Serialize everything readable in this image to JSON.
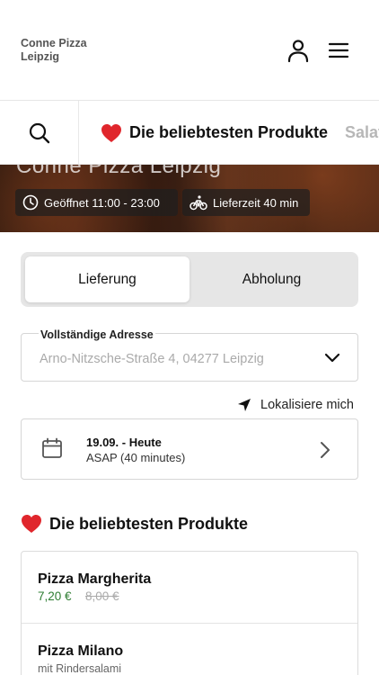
{
  "header": {
    "brand": "Conne Pizza Leipzig",
    "icons": {
      "user": "user-icon",
      "menu": "hamburger-menu-icon"
    }
  },
  "hero": {
    "title": "Conne Pizza Leipzig",
    "opening": "Geöffnet 11:00 - 23:00",
    "delivery_time": "Lieferzeit 40 min",
    "icons": {
      "opening": "clock-icon",
      "delivery": "bicycle-icon"
    }
  },
  "category_bar": {
    "icons": {
      "search": "search-icon",
      "active": "heart-icon"
    },
    "active_label": "Die beliebtesten Produkte",
    "next_label": "Salat"
  },
  "order_mode": {
    "options": [
      "Lieferung",
      "Abholung"
    ],
    "selected": "Lieferung"
  },
  "address": {
    "label": "Vollständige Adresse",
    "placeholder": "Arno-Nitzsche-Straße 4, 04277 Leipzig",
    "icon": "chevron-down-icon"
  },
  "locate": {
    "label": "Lokalisiere mich",
    "icon": "location-arrow-icon"
  },
  "schedule": {
    "date": "19.09. - Heute",
    "time": "ASAP (40 minutes)",
    "icons": {
      "calendar": "calendar-icon",
      "chevron": "chevron-right-icon"
    }
  },
  "section": {
    "title": "Die beliebtesten Produkte",
    "icon": "heart-icon"
  },
  "products": [
    {
      "name": "Pizza Margherita",
      "price": "7,20 €",
      "old_price": "8,00 €",
      "description": ""
    },
    {
      "name": "Pizza Milano",
      "price": "",
      "old_price": "",
      "description": "mit Rindersalami"
    }
  ],
  "colors": {
    "accent_red": "#e0262c",
    "price_green": "#2e7d32",
    "toggle_bg": "#e6e6e6"
  }
}
